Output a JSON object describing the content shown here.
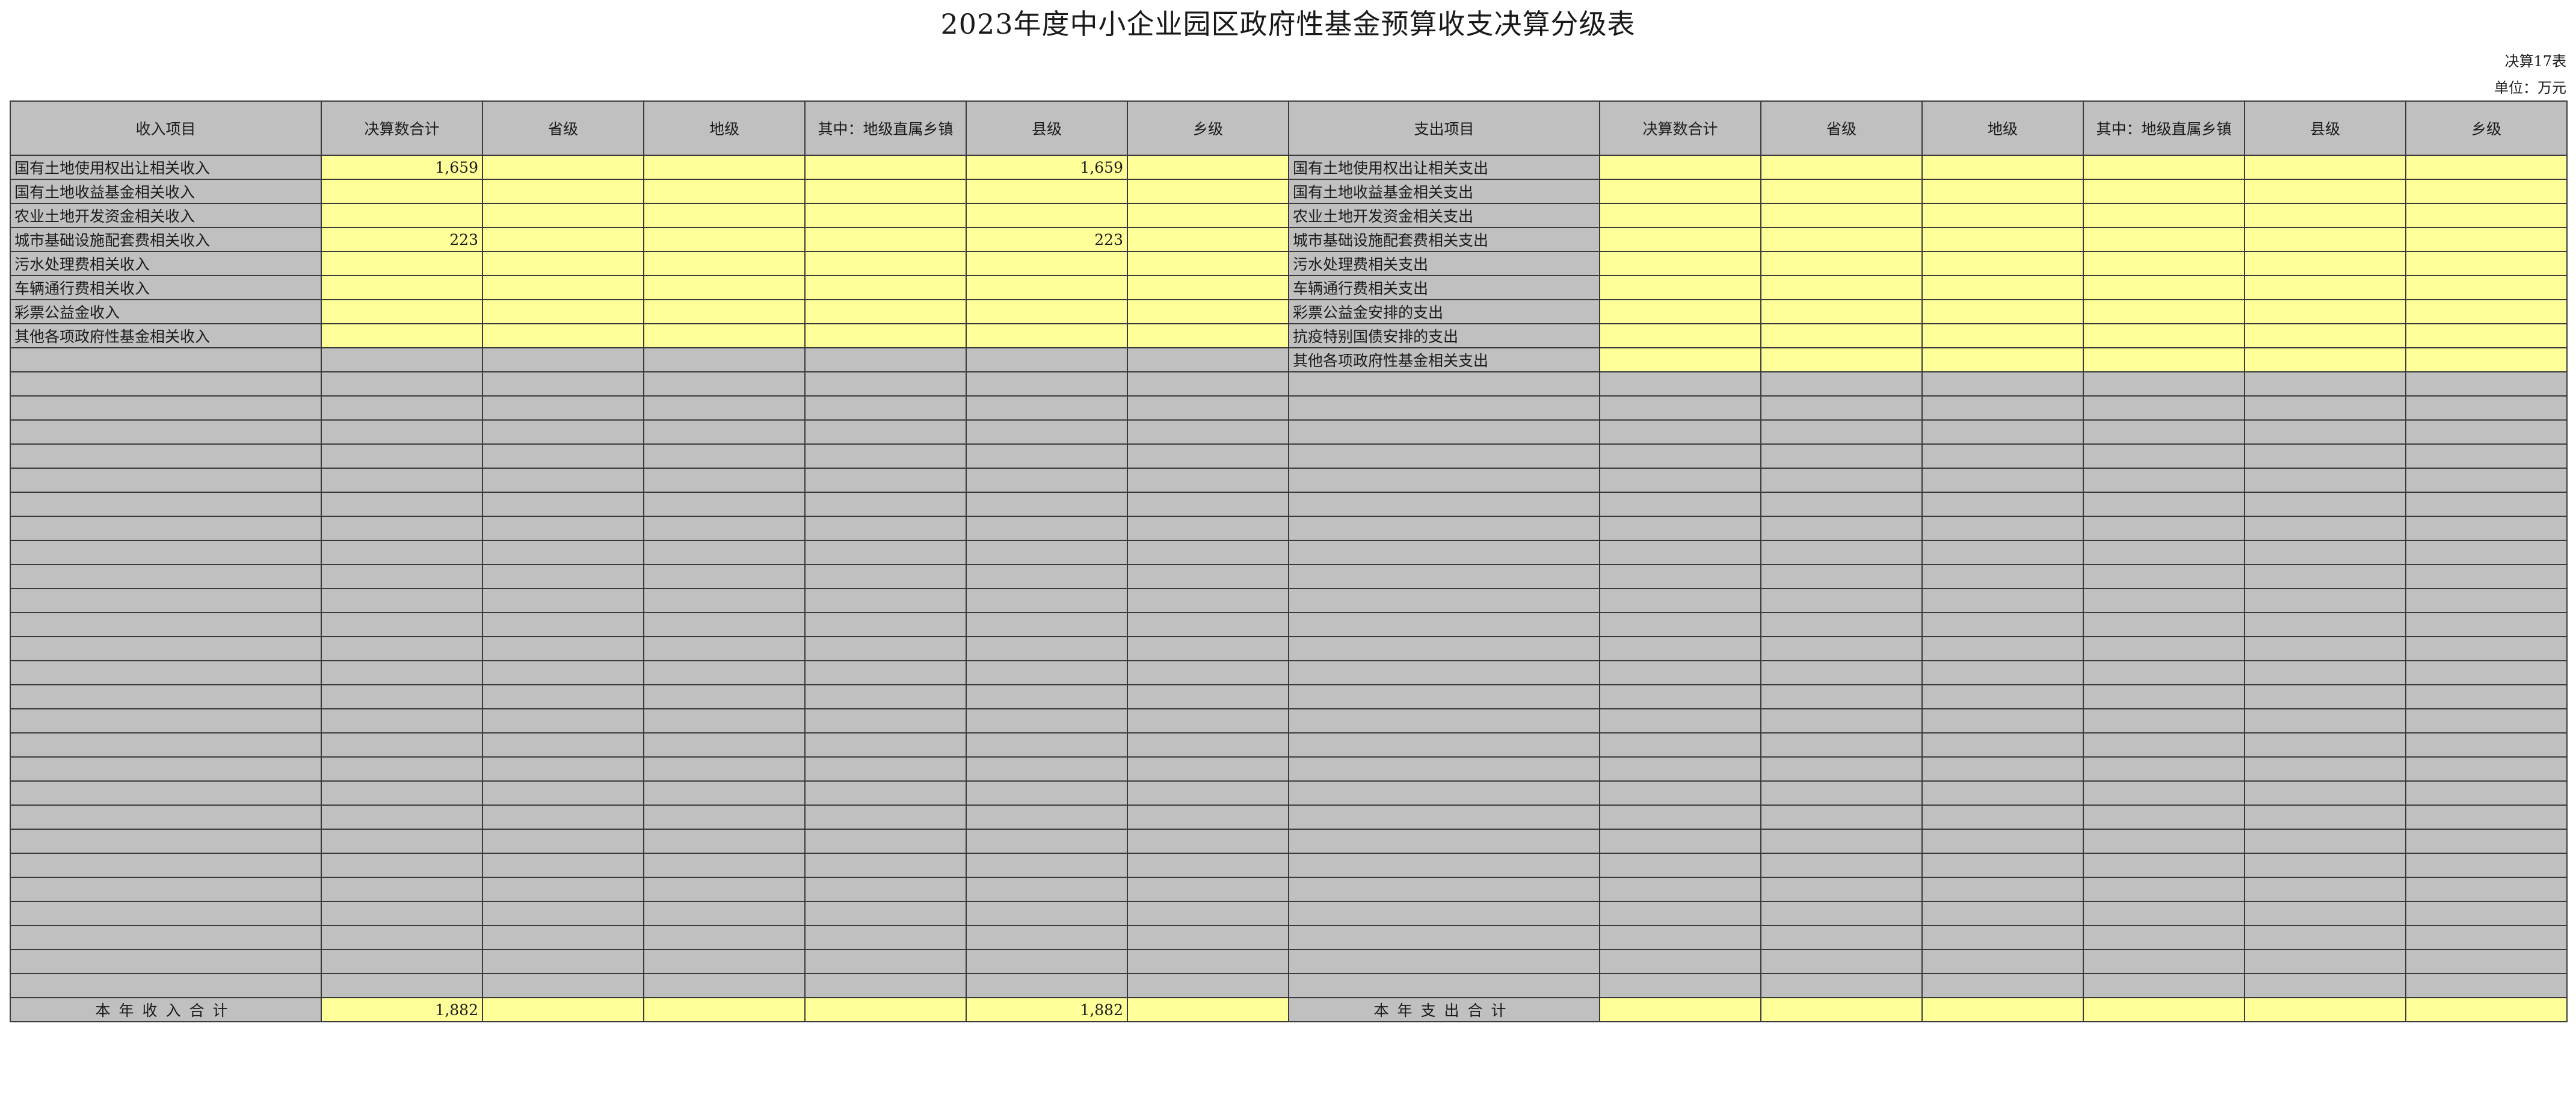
{
  "title": "2023年度中小企业园区政府性基金预算收支决算分级表",
  "table_no": "决算17表",
  "unit": "单位：万元",
  "headers": [
    "收入项目",
    "决算数合计",
    "省级",
    "地级",
    "其中：地级直属乡镇",
    "县级",
    "乡级",
    "支出项目",
    "决算数合计",
    "省级",
    "地级",
    "其中：地级直属乡镇",
    "县级",
    "乡级"
  ],
  "income_rows": [
    {
      "name": "国有土地使用权出让相关收入",
      "total": "1,659",
      "province": "",
      "prefecture": "",
      "direct_town": "",
      "county": "1,659",
      "township": ""
    },
    {
      "name": "国有土地收益基金相关收入",
      "total": "",
      "province": "",
      "prefecture": "",
      "direct_town": "",
      "county": "",
      "township": ""
    },
    {
      "name": "农业土地开发资金相关收入",
      "total": "",
      "province": "",
      "prefecture": "",
      "direct_town": "",
      "county": "",
      "township": ""
    },
    {
      "name": "城市基础设施配套费相关收入",
      "total": "223",
      "province": "",
      "prefecture": "",
      "direct_town": "",
      "county": "223",
      "township": ""
    },
    {
      "name": "污水处理费相关收入",
      "total": "",
      "province": "",
      "prefecture": "",
      "direct_town": "",
      "county": "",
      "township": ""
    },
    {
      "name": "车辆通行费相关收入",
      "total": "",
      "province": "",
      "prefecture": "",
      "direct_town": "",
      "county": "",
      "township": ""
    },
    {
      "name": "彩票公益金收入",
      "total": "",
      "province": "",
      "prefecture": "",
      "direct_town": "",
      "county": "",
      "township": ""
    },
    {
      "name": "其他各项政府性基金相关收入",
      "total": "",
      "province": "",
      "prefecture": "",
      "direct_town": "",
      "county": "",
      "township": ""
    }
  ],
  "expense_rows": [
    {
      "name": "国有土地使用权出让相关支出",
      "total": "",
      "province": "",
      "prefecture": "",
      "direct_town": "",
      "county": "",
      "township": ""
    },
    {
      "name": "国有土地收益基金相关支出",
      "total": "",
      "province": "",
      "prefecture": "",
      "direct_town": "",
      "county": "",
      "township": ""
    },
    {
      "name": "农业土地开发资金相关支出",
      "total": "",
      "province": "",
      "prefecture": "",
      "direct_town": "",
      "county": "",
      "township": ""
    },
    {
      "name": "城市基础设施配套费相关支出",
      "total": "",
      "province": "",
      "prefecture": "",
      "direct_town": "",
      "county": "",
      "township": ""
    },
    {
      "name": "污水处理费相关支出",
      "total": "",
      "province": "",
      "prefecture": "",
      "direct_town": "",
      "county": "",
      "township": ""
    },
    {
      "name": "车辆通行费相关支出",
      "total": "",
      "province": "",
      "prefecture": "",
      "direct_town": "",
      "county": "",
      "township": ""
    },
    {
      "name": "彩票公益金安排的支出",
      "total": "",
      "province": "",
      "prefecture": "",
      "direct_town": "",
      "county": "",
      "township": ""
    },
    {
      "name": "抗疫特别国债安排的支出",
      "total": "",
      "province": "",
      "prefecture": "",
      "direct_town": "",
      "county": "",
      "township": ""
    },
    {
      "name": "其他各项政府性基金相关支出",
      "total": "",
      "province": "",
      "prefecture": "",
      "direct_town": "",
      "county": "",
      "township": ""
    }
  ],
  "income_total": {
    "name": "本年收入合计",
    "total": "1,882",
    "province": "",
    "prefecture": "",
    "direct_town": "",
    "county": "1,882",
    "township": ""
  },
  "expense_total": {
    "name": "本年支出合计",
    "total": "",
    "province": "",
    "prefecture": "",
    "direct_town": "",
    "county": "",
    "township": ""
  }
}
